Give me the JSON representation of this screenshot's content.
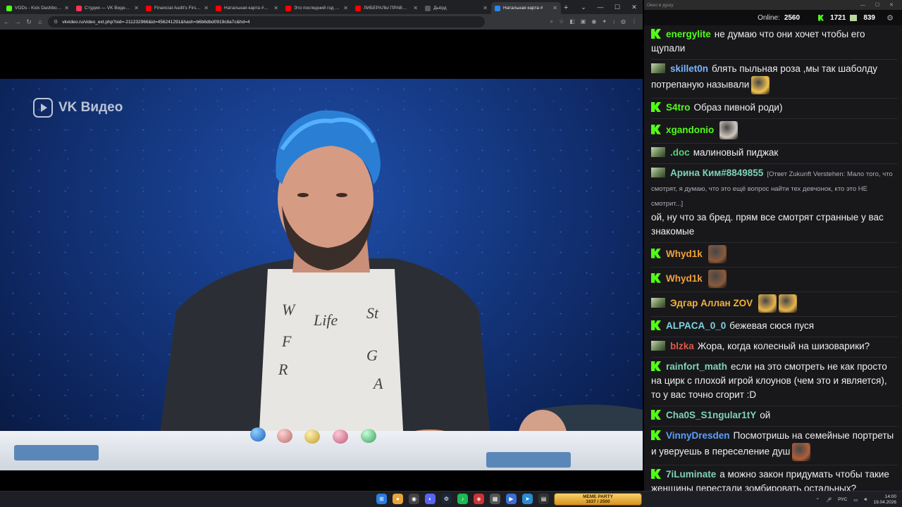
{
  "browser": {
    "tabs": [
      {
        "title": "VODs - Kick Dashboard",
        "fav": "#53fc18",
        "active": false
      },
      {
        "title": "Студия — VK Видео Live",
        "fav": "#ff3355",
        "active": false
      },
      {
        "title": "Financial Audit's First R",
        "fav": "#ff0000",
        "active": false
      },
      {
        "title": "Натальная карта #58 А",
        "fav": "#ff0000",
        "active": false
      },
      {
        "title": "Это последний год Пу",
        "fav": "#ff0000",
        "active": false
      },
      {
        "title": "ЛИБЕРАЛЫ ПРАВЫ ВО",
        "fav": "#ff0000",
        "active": false
      },
      {
        "title": "Дьёрд",
        "fav": "#5a5a5a",
        "active": false
      },
      {
        "title": "Натальная карта #",
        "fav": "#2787f5",
        "active": true
      }
    ],
    "new_tab": "+",
    "url": "vkvideo.ru/video_ext.php?oid=-211232966&id=456241291&hash=b6b6dbd0919c8a7c&hd=4",
    "window_controls": [
      "⌄",
      "—",
      "☐",
      "✕"
    ]
  },
  "video": {
    "watermark": "VK Видео"
  },
  "chat": {
    "window_title": "Окно в душу",
    "online_label": "Online:",
    "online_count": "2560",
    "kick_count": "1721",
    "twitch_count": "839",
    "messages": [
      {
        "platform": "k",
        "user": "energylite",
        "color": "#53fc18",
        "text": "не думаю что они хочет чтобы его щупали",
        "reply": "",
        "emotes": []
      },
      {
        "platform": "t",
        "user": "skillet0n",
        "color": "#79b6ff",
        "text": "блять пыльная роза ,мы так шаболду потрепаную называли",
        "reply": "",
        "emotes": [
          "#f2c14e"
        ]
      },
      {
        "platform": "k",
        "user": "S4tro",
        "color": "#53fc18",
        "text": "Образ пивной роди)",
        "reply": "",
        "emotes": []
      },
      {
        "platform": "k",
        "user": "xgandonio",
        "color": "#53fc18",
        "text": "",
        "reply": "",
        "emotes": [
          "#cfc7bd"
        ]
      },
      {
        "platform": "t",
        "user": ".doc",
        "color": "#56d17b",
        "text": "малиновый пиджак",
        "reply": "",
        "emotes": []
      },
      {
        "platform": "t",
        "user": "Арина Ким#8849855",
        "color": "#7fd3b5",
        "text": "ой, ну что за бред. прям все смотрят странные у вас знакомые",
        "reply": "[Ответ Zukunft Verstehen: Мало того, что смотрят, я думаю, что это ещё вопрос найти тех девчонок, кто это НЕ смотрит...]",
        "emotes": []
      },
      {
        "platform": "k",
        "user": "Whyd1k",
        "color": "#f0a23a",
        "text": "",
        "reply": "",
        "emotes": [
          "#8a5a3c"
        ]
      },
      {
        "platform": "k",
        "user": "Whyd1k",
        "color": "#f0a23a",
        "text": "",
        "reply": "",
        "emotes": [
          "#8a5a3c"
        ]
      },
      {
        "platform": "t",
        "user": "Эдгар Аллан ZOV",
        "color": "#f0b23a",
        "text": "",
        "reply": "",
        "emotes": [
          "#e8b54a",
          "#e8b54a"
        ]
      },
      {
        "platform": "k",
        "user": "ALPACA_0_0",
        "color": "#7fd3e0",
        "text": "бежевая сюся пуся",
        "reply": "",
        "emotes": []
      },
      {
        "platform": "t",
        "user": "blzka",
        "color": "#e0584a",
        "text": "Жора, когда колесный на шизоварики?",
        "reply": "",
        "emotes": []
      },
      {
        "platform": "k",
        "user": "rainfort_math",
        "color": "#7fd3b5",
        "text": "если на это смотреть не как просто на цирк с плохой игрой клоунов (чем это и является), то у вас точно сгорит :D",
        "reply": "",
        "emotes": []
      },
      {
        "platform": "k",
        "user": "Cha0S_S1ngular1tY",
        "color": "#7fd3b5",
        "text": "ой",
        "reply": "",
        "emotes": []
      },
      {
        "platform": "k",
        "user": "VinnyDresden",
        "color": "#5aa0ff",
        "text": "Посмотришь на семейные портреты и уверуешь в переселение душ",
        "reply": "",
        "emotes": [
          "#b0603a"
        ]
      },
      {
        "platform": "k",
        "user": "7iLuminate",
        "color": "#7fd3b5",
        "text": "а можно закон придумать чтобы такие женщины перестали зомбировать остальных?",
        "reply": "",
        "emotes": []
      }
    ]
  },
  "taskbar": {
    "meme_title": "MEME PARTY",
    "meme_progress": "1637 / 2500",
    "lang": "РУС",
    "time": "14:00",
    "date": "19.04.2026"
  }
}
